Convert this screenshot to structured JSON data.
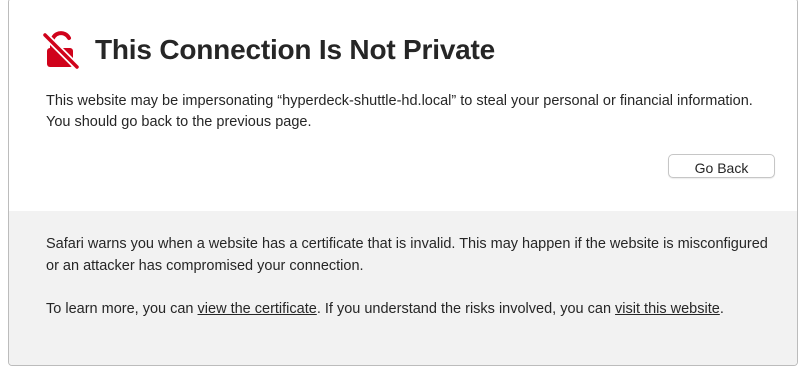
{
  "header": {
    "title": "This Connection Is Not Private",
    "icon": "unlocked-padlock-slash-icon",
    "icon_color": "#d0021b"
  },
  "message": {
    "text": "This website may be impersonating “hyperdeck-shuttle-hd.local” to steal your personal or financial information. You should go back to the previous page."
  },
  "actions": {
    "go_back_label": "Go Back"
  },
  "details": {
    "paragraph1": "Safari warns you when a website has a certificate that is invalid. This may happen if the website is misconfigured or an attacker has compromised your connection.",
    "paragraph2_prefix": "To learn more, you can ",
    "view_certificate_link": "view the certificate",
    "paragraph2_middle": ". If you understand the risks involved, you can ",
    "visit_website_link": "visit this website",
    "paragraph2_suffix": "."
  }
}
